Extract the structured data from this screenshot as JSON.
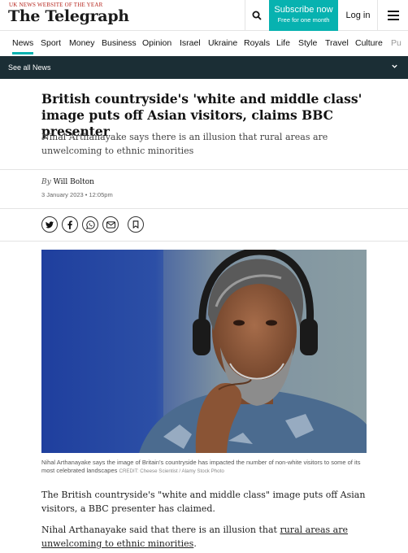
{
  "header": {
    "tagline": "UK NEWS WEBSITE OF THE YEAR",
    "logo": "The Telegraph",
    "subscribe_main": "Subscribe now",
    "subscribe_sub": "Free for one month",
    "login": "Log in",
    "search_icon": "search-icon",
    "menu_icon": "hamburger-menu-icon",
    "accent_color": "#07b2b0"
  },
  "nav": {
    "items": [
      {
        "label": "News",
        "active": true
      },
      {
        "label": "Sport"
      },
      {
        "label": "Money"
      },
      {
        "label": "Business"
      },
      {
        "label": "Opinion"
      },
      {
        "label": "Israel"
      },
      {
        "label": "Ukraine"
      },
      {
        "label": "Royals"
      },
      {
        "label": "Life"
      },
      {
        "label": "Style"
      },
      {
        "label": "Travel"
      },
      {
        "label": "Culture"
      },
      {
        "label": "Pu"
      }
    ],
    "see_all": "See all News"
  },
  "article": {
    "headline": "British countryside's 'white and middle class' image puts off Asian visitors, claims BBC presenter",
    "standfirst": "Nihal Arthanayake says there is an illusion that rural areas are unwelcoming to ethnic minorities",
    "by_prefix": "By",
    "author": "Will Bolton",
    "date": "3 January 2023 • 12:05pm",
    "share_icons": [
      "twitter-icon",
      "facebook-icon",
      "whatsapp-icon",
      "email-icon",
      "bookmark-icon"
    ],
    "caption": "Nihal Arthanayake says the image of Britain's countryside has impacted the number of non-white visitors to some of its most celebrated landscapes",
    "credit": "CREDIT: Cheese Scientist / Alamy Stock Photo",
    "p1": "The British countryside's \"white and middle class\" image puts off Asian visitors, a BBC presenter has claimed.",
    "p2_before": "Nihal Arthanayake said that there is an illusion that ",
    "p2_link": "rural areas are unwelcoming to ethnic minorities",
    "p2_after": "."
  }
}
